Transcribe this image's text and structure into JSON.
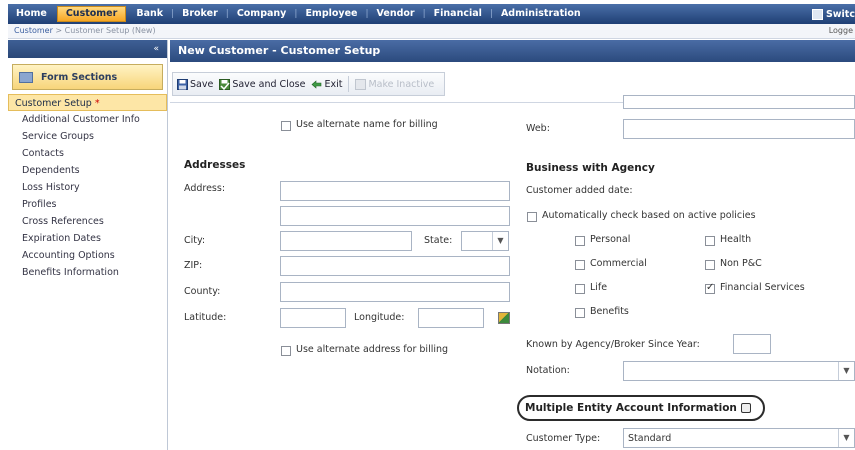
{
  "nav": {
    "items": [
      "Home",
      "Customer",
      "Bank",
      "Broker",
      "Company",
      "Employee",
      "Vendor",
      "Financial",
      "Administration"
    ],
    "active": "Customer",
    "switch_label": "Switc"
  },
  "breadcrumb": {
    "link": "Customer",
    "separator": ">",
    "current": "Customer Setup (New)",
    "logged": "Logge"
  },
  "sidebar": {
    "collapse_glyph": "«",
    "header": "Form Sections",
    "items": [
      {
        "label": "Customer Setup",
        "required": "*"
      },
      {
        "label": "Additional Customer Info"
      },
      {
        "label": "Service Groups"
      },
      {
        "label": "Contacts"
      },
      {
        "label": "Dependents"
      },
      {
        "label": "Loss History"
      },
      {
        "label": "Profiles"
      },
      {
        "label": "Cross References"
      },
      {
        "label": "Expiration Dates"
      },
      {
        "label": "Accounting Options"
      },
      {
        "label": "Benefits Information"
      }
    ]
  },
  "main": {
    "title": "New Customer - Customer Setup",
    "toolbar": {
      "save": "Save",
      "save_close": "Save and Close",
      "exit": "Exit",
      "make_inactive": "Make Inactive"
    }
  },
  "form": {
    "alt_name_billing": "Use alternate name for billing",
    "web_label": "Web:",
    "addresses_heading": "Addresses",
    "address_label": "Address:",
    "city_label": "City:",
    "state_label": "State:",
    "zip_label": "ZIP:",
    "county_label": "County:",
    "latitude_label": "Latitude:",
    "longitude_label": "Longitude:",
    "alt_address_billing": "Use alternate address for billing",
    "business_heading": "Business with Agency",
    "customer_added_date": "Customer added date:",
    "auto_check": "Automatically check based on active policies",
    "personal": "Personal",
    "health": "Health",
    "commercial": "Commercial",
    "non_pc": "Non P&C",
    "life": "Life",
    "financial_services": "Financial Services",
    "benefits": "Benefits",
    "known_since": "Known by Agency/Broker Since Year:",
    "notation_label": "Notation:",
    "mei_heading": "Multiple Entity Account Information",
    "customer_type_label": "Customer Type:",
    "customer_type_value": "Standard"
  }
}
